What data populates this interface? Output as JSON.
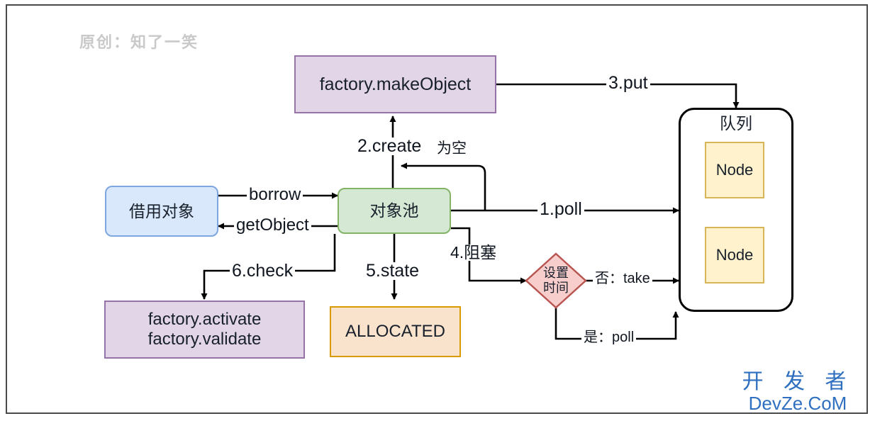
{
  "watermarks": {
    "top_left": "原创：知了一笑",
    "bottom_right_cn": "开 发 者",
    "bottom_right_en": "DevZe.CoM"
  },
  "colors": {
    "purple_fill": "#e1d5e7",
    "purple_stroke": "#9673a6",
    "blue_fill": "#dae8fc",
    "blue_stroke": "#7ea6e0",
    "green_fill": "#d5e8d4",
    "green_stroke": "#82b366",
    "orange_fill": "#fae3cd",
    "orange_stroke": "#d79b00",
    "yellow_fill": "#fff2cc",
    "yellow_stroke": "#d6b656",
    "pink_fill": "#f8cecc",
    "pink_stroke": "#b85450",
    "edge": "#000000",
    "frame": "#4a4a4a",
    "watermark_blue": "#2f6fc0",
    "watermark_gray": "#c9c9c9"
  },
  "nodes": {
    "make_object": "factory.makeObject",
    "queue_title": "队列",
    "queue_node_1": "Node",
    "queue_node_2": "Node",
    "borrow_object": "借用对象",
    "object_pool": "对象池",
    "factory_check_line1": "factory.activate",
    "factory_check_line2": "factory.validate",
    "allocated": "ALLOCATED",
    "decision_line1": "设置",
    "decision_line2": "时间"
  },
  "edges": {
    "borrow": "borrow",
    "get_object": "getObject",
    "create": "2.create",
    "is_empty": "为空",
    "put": "3.put",
    "poll": "1.poll",
    "block": "4.阻塞",
    "state": "5.state",
    "check": "6.check",
    "decision_no": "否：take",
    "decision_yes": "是：poll"
  }
}
